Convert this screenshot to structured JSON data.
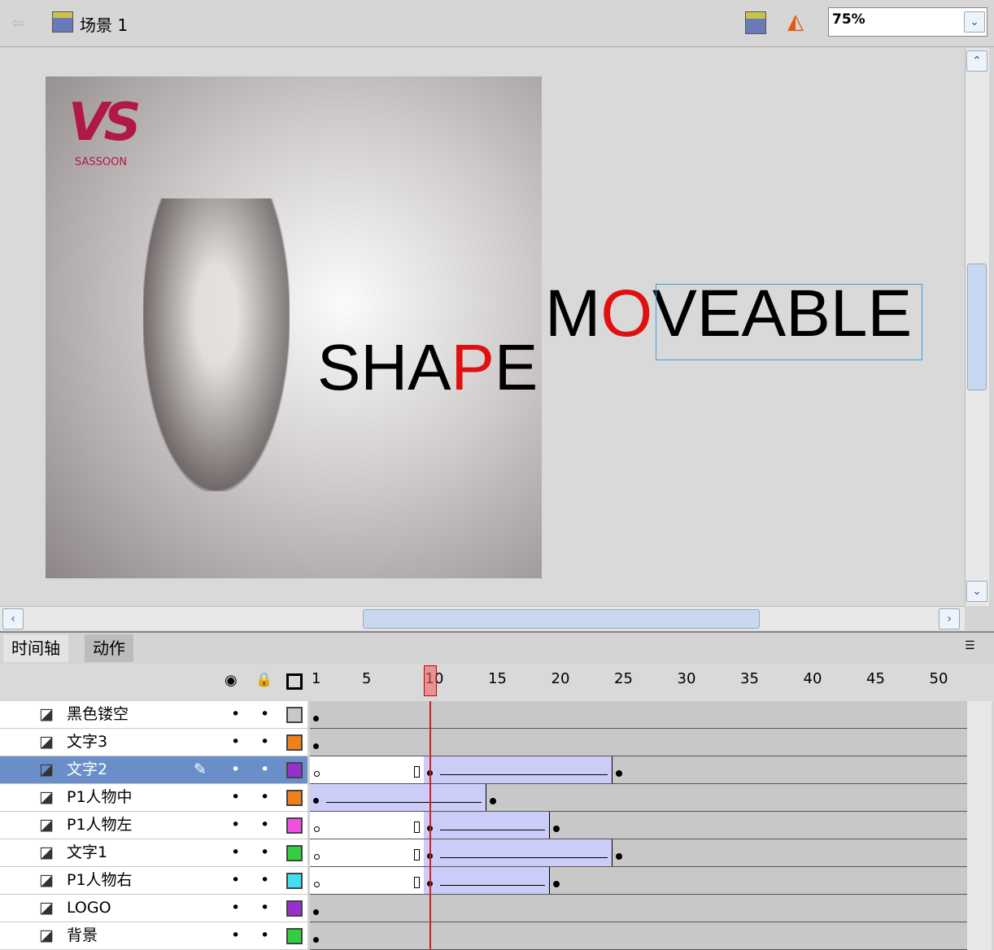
{
  "toolbar": {
    "scene_label": "场景 1",
    "zoom_value": "75%"
  },
  "stage": {
    "logo_text": "VS",
    "logo_sub": "SASSOON",
    "word1_a": "SHA",
    "word1_b": "P",
    "word1_c": "E",
    "word2_a": "M",
    "word2_b": "O",
    "word2_c": "VEABLE"
  },
  "timeline": {
    "tabs": [
      "时间轴",
      "动作"
    ],
    "frame_numbers": [
      "1",
      "5",
      "10",
      "15",
      "20",
      "25",
      "30",
      "35",
      "40",
      "45",
      "50"
    ],
    "current_frame": 10,
    "layers": [
      {
        "name": "黑色镂空",
        "color": "#c8c8c8",
        "blank_until": 0,
        "tween": null,
        "key": 1
      },
      {
        "name": "文字3",
        "color": "#f0801a",
        "blank_until": 0,
        "tween": null,
        "key": 1
      },
      {
        "name": "文字2",
        "color": "#9a2fd0",
        "blank_until": 9,
        "tween": [
          10,
          24
        ],
        "end": 25,
        "selected": true
      },
      {
        "name": "P1人物中",
        "color": "#f0801a",
        "blank_until": 0,
        "tween": [
          1,
          14
        ],
        "end": 15
      },
      {
        "name": "P1人物左",
        "color": "#f050e0",
        "blank_until": 9,
        "tween": [
          10,
          19
        ],
        "end": 20
      },
      {
        "name": "文字1",
        "color": "#30d040",
        "blank_until": 9,
        "tween": [
          10,
          24
        ],
        "end": 25
      },
      {
        "name": "P1人物右",
        "color": "#40e0f0",
        "blank_until": 9,
        "tween": [
          10,
          19
        ],
        "end": 20
      },
      {
        "name": "LOGO",
        "color": "#9a2fd0",
        "blank_until": 0,
        "tween": null,
        "key": 1
      },
      {
        "name": "背景",
        "color": "#30d040",
        "blank_until": 0,
        "tween": null,
        "key": 1
      }
    ]
  }
}
